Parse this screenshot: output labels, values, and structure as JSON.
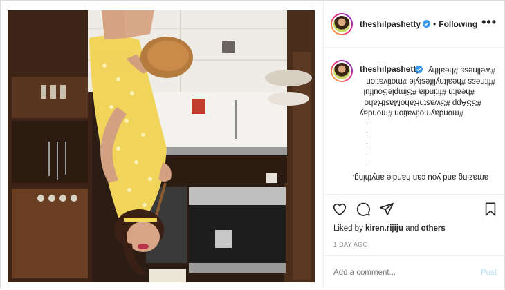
{
  "post": {
    "username": "theshilpashetty",
    "follow_status": "Following",
    "separator": "•",
    "more_label": "•••",
    "caption_lines": [
      "#wellness #healthy",
      "#fitness #healthylifestyle #motivation",
      "#health #fitindia #SimpleSoulful",
      "#SSApp #SwasthRahoMastRaho",
      "#mondaymotivation #monday",
      ".",
      ".",
      ".",
      ".",
      ".",
      "amazing and you can handle anything."
    ],
    "liked_by_prefix": "Liked by",
    "liked_by_user": "kiren.rijiju",
    "liked_by_suffix_and": "and",
    "liked_by_others": "others",
    "timestamp": "1 DAY AGO",
    "comment_placeholder": "Add a comment...",
    "post_label": "Post"
  },
  "icons": {
    "verified": "verified-badge-icon",
    "like": "heart-icon",
    "comment": "comment-icon",
    "share": "paper-plane-icon",
    "save": "bookmark-icon",
    "more": "more-options-icon"
  },
  "colors": {
    "verified": "#3897f0",
    "muted": "#8e8e8e",
    "post_disabled": "#b2dffc",
    "border": "#dbdbdb",
    "text": "#262626"
  }
}
